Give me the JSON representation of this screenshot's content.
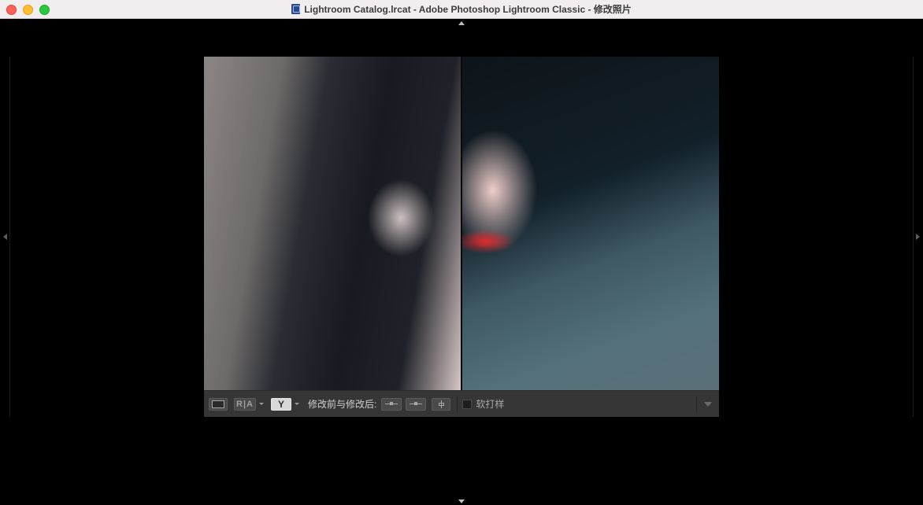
{
  "window": {
    "title": "Lightroom Catalog.lrcat - Adobe Photoshop Lightroom Classic - 修改照片",
    "icon": "catalog-doc-icon"
  },
  "toolbar": {
    "view_ra_label": "R|A",
    "survey_label": "Y",
    "before_after_label": "修改前与修改后:",
    "soft_proof_label": "软打样",
    "soft_proof_checked": false
  },
  "colors": {
    "background": "#000000",
    "toolbar": "#363636",
    "titlebar": "#f2eef0"
  }
}
